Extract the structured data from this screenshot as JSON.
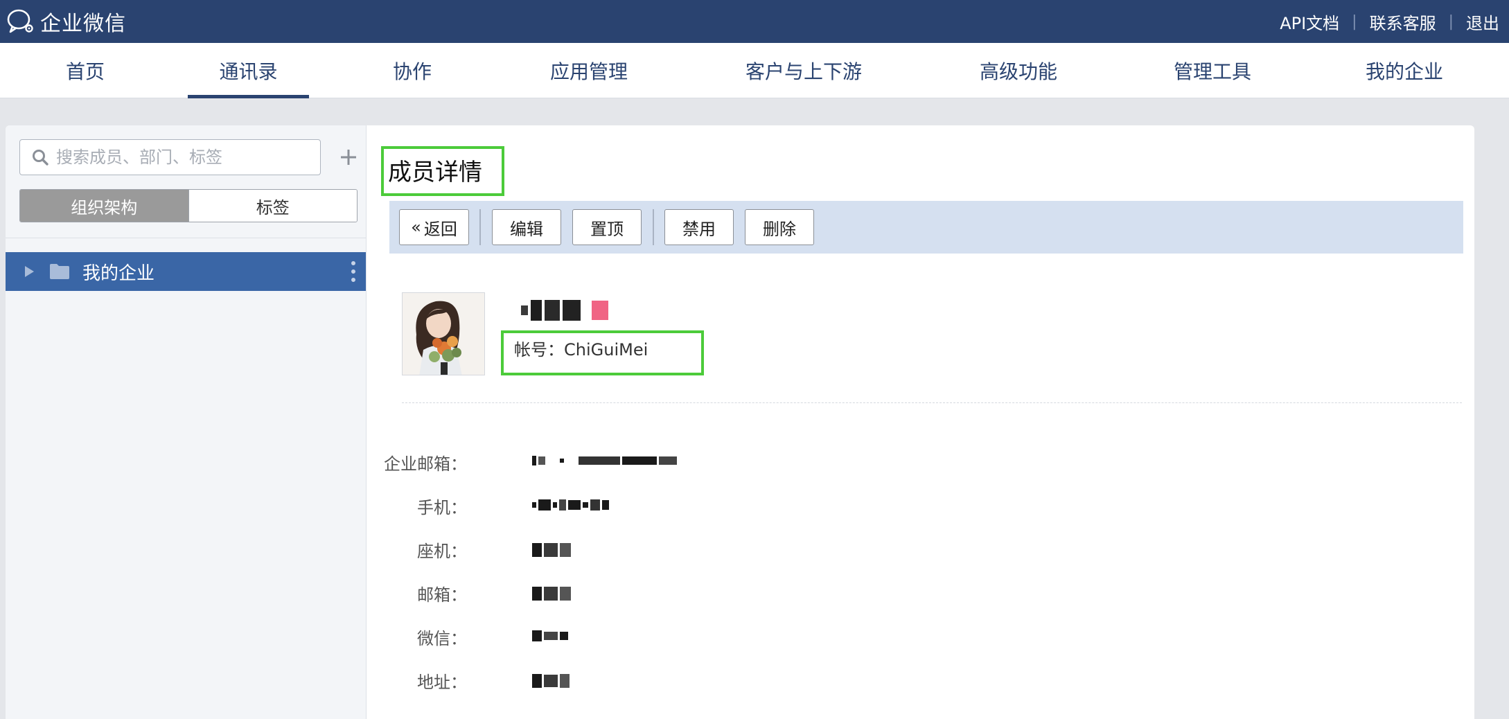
{
  "app": {
    "title": "企业微信"
  },
  "top_links": [
    "API文档",
    "联系客服",
    "退出"
  ],
  "nav": {
    "items": [
      {
        "label": "首页"
      },
      {
        "label": "通讯录"
      },
      {
        "label": "协作"
      },
      {
        "label": "应用管理"
      },
      {
        "label": "客户与上下游"
      },
      {
        "label": "高级功能"
      },
      {
        "label": "管理工具"
      },
      {
        "label": "我的企业"
      }
    ],
    "active": "通讯录"
  },
  "sidebar": {
    "search_placeholder": "搜索成员、部门、标签",
    "tabs": [
      {
        "label": "组织架构",
        "selected": true
      },
      {
        "label": "标签",
        "selected": false
      }
    ],
    "tree": [
      {
        "label": "我的企业",
        "selected": true
      }
    ]
  },
  "detail": {
    "title": "成员详情",
    "buttons": {
      "back": "返回",
      "edit": "编辑",
      "pin": "置顶",
      "disable": "禁用",
      "delete": "删除"
    },
    "account_label": "帐号：",
    "account": "ChiGuiMei",
    "fields": [
      {
        "label": "企业邮箱："
      },
      {
        "label": "手机："
      },
      {
        "label": "座机："
      },
      {
        "label": "邮箱："
      },
      {
        "label": "微信："
      },
      {
        "label": "地址："
      }
    ]
  },
  "colors": {
    "topbar": "#2a4370",
    "highlight_box": "#4ccb3a",
    "toolbar": "#d5e0f0",
    "tree_selected": "#3a66a6"
  }
}
